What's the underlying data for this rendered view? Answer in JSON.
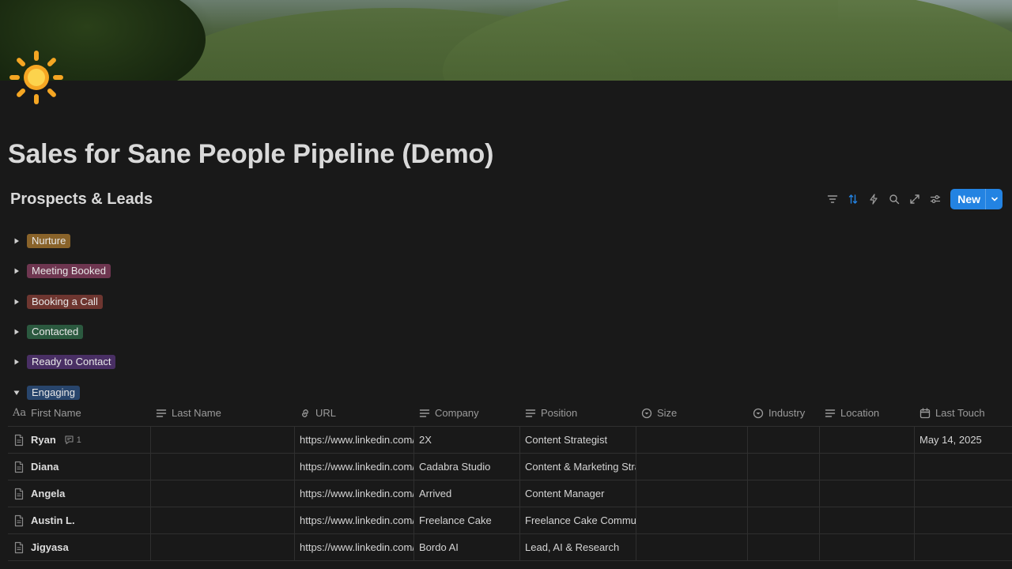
{
  "page": {
    "icon": "sun-icon",
    "title": "Sales for Sane People Pipeline (Demo)"
  },
  "database": {
    "title": "Prospects & Leads",
    "toolbar": {
      "icons": [
        "filter-icon",
        "sort-icon",
        "automation-icon",
        "search-icon",
        "expand-icon",
        "settings-icon"
      ],
      "new_label": "New"
    }
  },
  "colors": {
    "accent": "#2383e2",
    "background": "#191919"
  },
  "groups": [
    {
      "label": "Nurture",
      "color": "#89632a",
      "expanded": false
    },
    {
      "label": "Meeting Booked",
      "color": "#6e3650",
      "expanded": false
    },
    {
      "label": "Booking a Call",
      "color": "#6e3630",
      "expanded": false
    },
    {
      "label": "Contacted",
      "color": "#2b593f",
      "expanded": false
    },
    {
      "label": "Ready to Contact",
      "color": "#492f64",
      "expanded": false
    },
    {
      "label": "Engaging",
      "color": "#28456c",
      "expanded": true
    }
  ],
  "table": {
    "columns": [
      {
        "label": "First Name",
        "icon": "title-icon"
      },
      {
        "label": "Last Name",
        "icon": "text-icon"
      },
      {
        "label": "URL",
        "icon": "link-icon"
      },
      {
        "label": "Company",
        "icon": "text-icon"
      },
      {
        "label": "Position",
        "icon": "text-icon"
      },
      {
        "label": "Size",
        "icon": "select-icon"
      },
      {
        "label": "Industry",
        "icon": "select-icon"
      },
      {
        "label": "Location",
        "icon": "text-icon"
      },
      {
        "label": "Last Touch",
        "icon": "calendar-icon"
      }
    ],
    "rows": [
      {
        "first_name": "Ryan",
        "comments": "1",
        "last_name": "",
        "url": "https://www.linkedin.com/in/",
        "company": "2X",
        "position": "Content Strategist",
        "size": "",
        "industry": "",
        "location": "",
        "last_touch": "May 14, 2025"
      },
      {
        "first_name": "Diana",
        "comments": "",
        "last_name": "",
        "url": "https://www.linkedin.com/in/",
        "company": "Cadabra Studio",
        "position": "Content & Marketing Strategist",
        "size": "",
        "industry": "",
        "location": "",
        "last_touch": ""
      },
      {
        "first_name": "Angela",
        "comments": "",
        "last_name": "",
        "url": "https://www.linkedin.com/in/",
        "company": "Arrived",
        "position": "Content Manager",
        "size": "",
        "industry": "",
        "location": "",
        "last_touch": ""
      },
      {
        "first_name": "Austin L.",
        "comments": "",
        "last_name": "",
        "url": "https://www.linkedin.com/in/",
        "company": "Freelance Cake",
        "position": "Freelance Cake Community",
        "size": "",
        "industry": "",
        "location": "",
        "last_touch": ""
      },
      {
        "first_name": "Jigyasa",
        "comments": "",
        "last_name": "",
        "url": "https://www.linkedin.com/in/",
        "company": "Bordo AI",
        "position": "Lead, AI & Research",
        "size": "",
        "industry": "",
        "location": "",
        "last_touch": ""
      }
    ]
  }
}
